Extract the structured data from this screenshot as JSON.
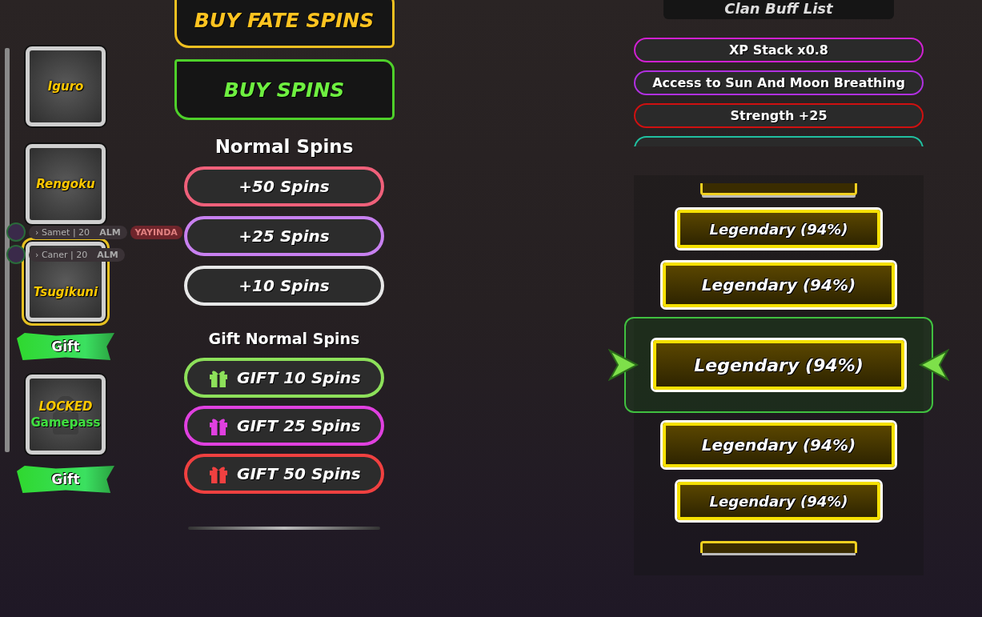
{
  "sidebar": {
    "items": [
      {
        "kind": "card",
        "label": "Iguro",
        "selected": false
      },
      {
        "kind": "card",
        "label": "Rengoku",
        "selected": false
      },
      {
        "kind": "card",
        "label": "Tsugikuni",
        "selected": true
      },
      {
        "kind": "gift",
        "label": "Gift",
        "selected": false
      },
      {
        "kind": "locked",
        "label": "LOCKED",
        "sublabel": "Gamepass",
        "selected": false
      },
      {
        "kind": "gift",
        "label": "Gift",
        "selected": false
      }
    ]
  },
  "shop": {
    "buy_fate_spins": "BUY FATE SPINS",
    "buy_spins": "BUY SPINS",
    "normal_heading": "Normal Spins",
    "normal_spins": [
      {
        "label": "+50 Spins",
        "color": "#f0607a"
      },
      {
        "label": "+25 Spins",
        "color": "#c880f0"
      },
      {
        "label": "+10 Spins",
        "color": "#e8e8e8"
      }
    ],
    "gift_heading": "Gift Normal Spins",
    "gift_spins": [
      {
        "label": "GIFT 10 Spins",
        "color": "#8de05a"
      },
      {
        "label": "GIFT 25 Spins",
        "color": "#e040e0"
      },
      {
        "label": "GIFT 50 Spins",
        "color": "#f04040"
      }
    ]
  },
  "clan": {
    "title": "Clan Buff List",
    "buffs": [
      {
        "label": "XP Stack x0.8",
        "color": "#d020d0"
      },
      {
        "label": "Access to Sun And Moon Breathing",
        "color": "#b030e0"
      },
      {
        "label": "Strength +25",
        "color": "#d01010"
      },
      {
        "color": "#20c0a0"
      }
    ]
  },
  "reel": {
    "items": [
      {
        "label": "Legendary (94%)",
        "selected": false
      },
      {
        "label": "Legendary (94%)",
        "selected": false
      },
      {
        "label": "Legendary (94%)",
        "selected": true
      },
      {
        "label": "Legendary (94%)",
        "selected": false
      },
      {
        "label": "Legendary (94%)",
        "selected": false
      }
    ]
  },
  "chat": [
    {
      "name": "› Samet | 20",
      "tag": "ALM",
      "badge": "YAYINDA"
    },
    {
      "name": "› Caner | 20",
      "tag": "ALM"
    }
  ]
}
